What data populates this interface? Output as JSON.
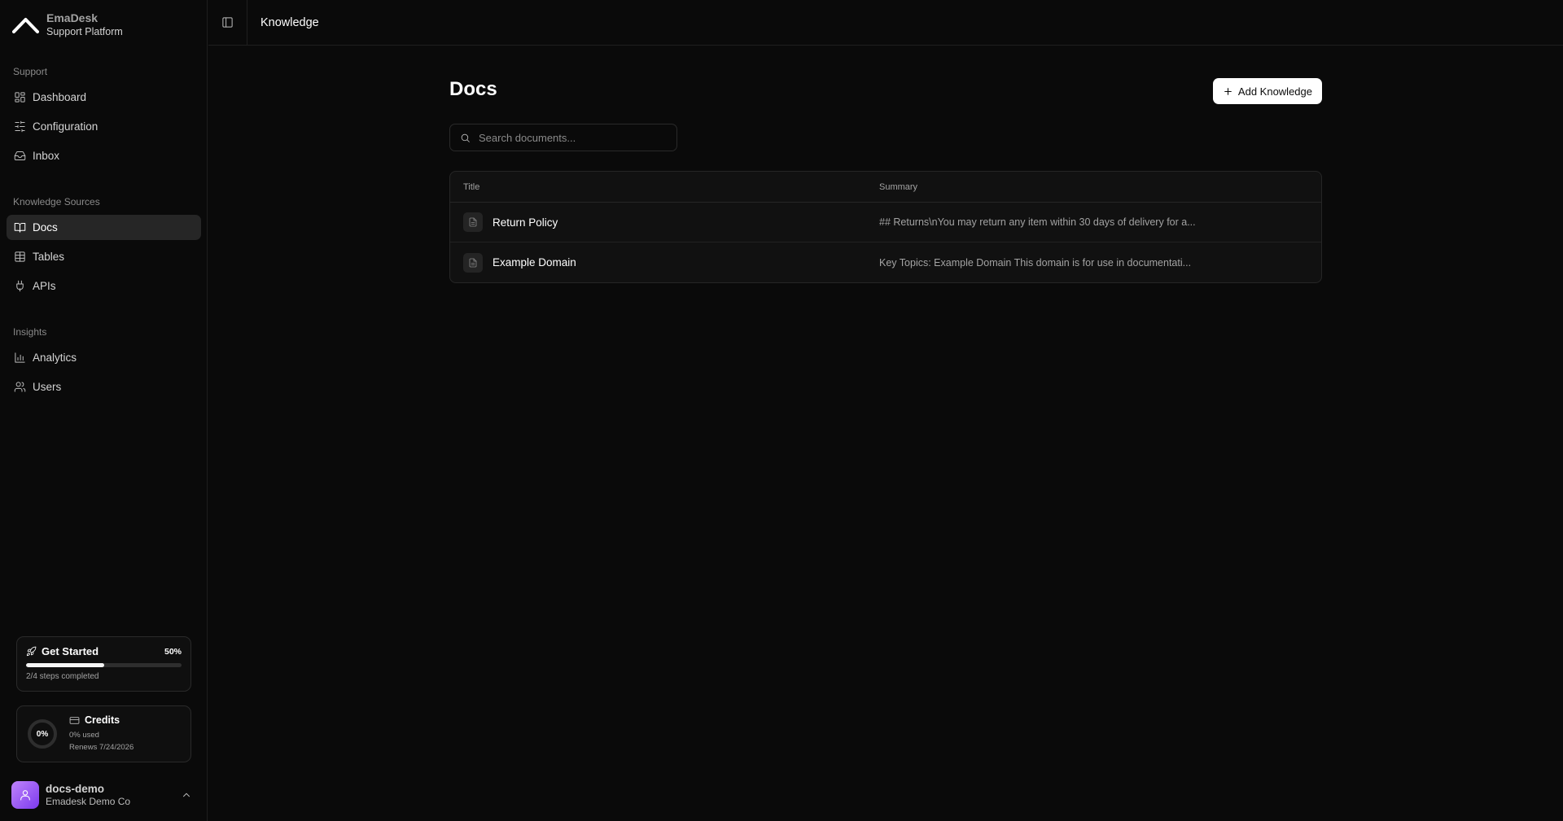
{
  "brand": {
    "name": "EmaDesk",
    "subtitle": "Support Platform"
  },
  "sidebar": {
    "groups": [
      {
        "label": "Support",
        "items": [
          {
            "label": "Dashboard",
            "icon": "dashboard-icon"
          },
          {
            "label": "Configuration",
            "icon": "sliders-icon"
          },
          {
            "label": "Inbox",
            "icon": "inbox-icon"
          }
        ]
      },
      {
        "label": "Knowledge Sources",
        "items": [
          {
            "label": "Docs",
            "icon": "book-open-icon",
            "active": true
          },
          {
            "label": "Tables",
            "icon": "table-icon"
          },
          {
            "label": "APIs",
            "icon": "plug-icon"
          }
        ]
      },
      {
        "label": "Insights",
        "items": [
          {
            "label": "Analytics",
            "icon": "bar-chart-icon"
          },
          {
            "label": "Users",
            "icon": "users-icon"
          }
        ]
      }
    ]
  },
  "get_started": {
    "title": "Get Started",
    "percent_label": "50%",
    "progress": 0.5,
    "steps": "2/4 steps completed"
  },
  "credits": {
    "title": "Credits",
    "ring_label": "0%",
    "used": "0% used",
    "renews": "Renews 7/24/2026",
    "usage": 0
  },
  "user": {
    "name": "docs-demo",
    "org": "Emadesk Demo Co"
  },
  "topbar": {
    "breadcrumb": "Knowledge"
  },
  "main": {
    "title": "Docs",
    "add_button": "Add Knowledge",
    "search_placeholder": "Search documents...",
    "table": {
      "columns": [
        "Title",
        "Summary"
      ],
      "rows": [
        {
          "title": "Return Policy",
          "summary": "## Returns\\nYou may return any item within 30 days of delivery for a..."
        },
        {
          "title": "Example Domain",
          "summary": "Key Topics: Example Domain This domain is for use in documentati..."
        }
      ]
    }
  },
  "colors": {
    "background": "#0a0a0a",
    "active_nav": "#262626",
    "avatar_gradient_start": "#c084fc",
    "avatar_gradient_end": "#7c3aed"
  }
}
